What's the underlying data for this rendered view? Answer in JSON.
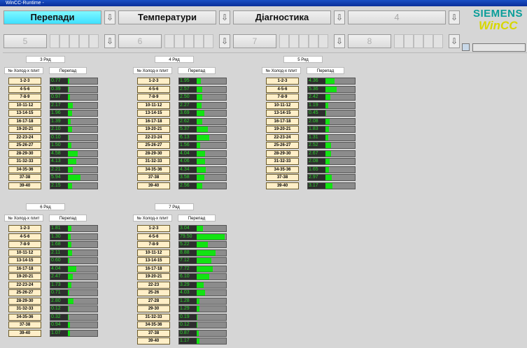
{
  "window": {
    "title": "WinCC-Runtime -"
  },
  "nav_row1": [
    {
      "label": "Перепади",
      "active": true
    },
    {
      "label": "Температури",
      "active": false
    },
    {
      "label": "Діагностика",
      "active": false
    },
    {
      "label": "4",
      "active": false
    }
  ],
  "nav_row2": [
    "5",
    "6",
    "7",
    "8"
  ],
  "arrow_glyph": "⇩",
  "logo": {
    "line1": "SIEMENS",
    "line2": "WinCC"
  },
  "column_headers": {
    "plates": "№ Холод-х плит",
    "drop": "Перепад"
  },
  "panels": [
    {
      "title": "3 Ряд",
      "rows": [
        {
          "label": "1-2-3",
          "value": "0.77"
        },
        {
          "label": "4-5-6",
          "value": "0.39"
        },
        {
          "label": "7-8-9",
          "value": "0.97"
        },
        {
          "label": "10-11-12",
          "value": "2.17"
        },
        {
          "label": "13-14-15",
          "value": "1.96"
        },
        {
          "label": "16-17-18",
          "value": "1.39"
        },
        {
          "label": "19-20-21",
          "value": "2.10"
        },
        {
          "label": "22-23-24",
          "value": "0.10"
        },
        {
          "label": "25-26-27",
          "value": "1.50"
        },
        {
          "label": "28-29-30",
          "value": "4.58"
        },
        {
          "label": "31-32-33",
          "value": "4.13"
        },
        {
          "label": "34-35-36",
          "value": "2.21"
        },
        {
          "label": "37-38",
          "value": "5.94"
        },
        {
          "label": "39-40",
          "value": "2.15"
        }
      ]
    },
    {
      "title": "4 Ряд",
      "rows": [
        {
          "label": "1-2-3",
          "value": "1.95"
        },
        {
          "label": "4-5-6",
          "value": "2.57"
        },
        {
          "label": "7-8-9",
          "value": "2.50"
        },
        {
          "label": "10-11-12",
          "value": "2.27"
        },
        {
          "label": "13-14-15",
          "value": "3.69"
        },
        {
          "label": "16-17-18",
          "value": "2.62"
        },
        {
          "label": "19-20-21",
          "value": "5.37"
        },
        {
          "label": "22-23-24",
          "value": "6.13"
        },
        {
          "label": "25-26-27",
          "value": "1.56"
        },
        {
          "label": "28-29-30",
          "value": "4.04"
        },
        {
          "label": "31-32-33",
          "value": "4.06"
        },
        {
          "label": "34-35-36",
          "value": "4.34"
        },
        {
          "label": "37-38",
          "value": "3.58"
        },
        {
          "label": "39-40",
          "value": "2.56"
        }
      ]
    },
    {
      "title": "5 Ряд",
      "rows": [
        {
          "label": "1-2-3",
          "value": "4.36"
        },
        {
          "label": "4-5-6",
          "value": "5.36"
        },
        {
          "label": "7-8-9",
          "value": "2.42"
        },
        {
          "label": "10-11-12",
          "value": "1.19"
        },
        {
          "label": "13-14-15",
          "value": "0.45"
        },
        {
          "label": "16-17-18",
          "value": "2.08"
        },
        {
          "label": "19-20-21",
          "value": "1.83"
        },
        {
          "label": "22-23-24",
          "value": "1.31"
        },
        {
          "label": "25-26-27",
          "value": "2.52"
        },
        {
          "label": "28-29-30",
          "value": "2.67"
        },
        {
          "label": "31-32-33",
          "value": "2.08"
        },
        {
          "label": "34-35-36",
          "value": "1.65"
        },
        {
          "label": "37-38",
          "value": "2.97"
        },
        {
          "label": "39-40",
          "value": "3.17"
        }
      ]
    },
    {
      "title": "6 Ряд",
      "rows": [
        {
          "label": "1-2-3",
          "value": "1.81"
        },
        {
          "label": "4-5-6",
          "value": "1.30"
        },
        {
          "label": "7-8-9",
          "value": "1.68"
        },
        {
          "label": "10-11-12",
          "value": "2.11"
        },
        {
          "label": "13-14-15",
          "value": "0.60"
        },
        {
          "label": "16-17-18",
          "value": "4.04"
        },
        {
          "label": "19-20-21",
          "value": "2.47"
        },
        {
          "label": "22-23-24",
          "value": "1.73"
        },
        {
          "label": "25-26-27",
          "value": "0.71"
        },
        {
          "label": "28-29-30",
          "value": "2.80"
        },
        {
          "label": "31-32-33",
          "value": "0.12"
        },
        {
          "label": "34-35-36",
          "value": "0.32"
        },
        {
          "label": "37-38",
          "value": "0.94"
        },
        {
          "label": "39-40",
          "value": "1.07"
        }
      ]
    },
    {
      "title": "7 Ряд",
      "rows": [
        {
          "label": "1-2-3",
          "value": "3.04"
        },
        {
          "label": "4-5-6",
          "value": "79.50"
        },
        {
          "label": "7-8-9",
          "value": "5.22"
        },
        {
          "label": "10-11-12",
          "value": "8.88"
        },
        {
          "label": "13-14-15",
          "value": "7.12"
        },
        {
          "label": "16-17-18",
          "value": "7.72"
        },
        {
          "label": "19-20-21",
          "value": "6.10"
        },
        {
          "label": "22-23",
          "value": "3.29"
        },
        {
          "label": "25-26",
          "value": "4.03"
        },
        {
          "label": "27-28",
          "value": "1.28"
        },
        {
          "label": "29-30",
          "value": "1.29"
        },
        {
          "label": "31-32-33",
          "value": "0.19"
        },
        {
          "label": "34-35-36",
          "value": "0.12"
        },
        {
          "label": "37-38",
          "value": "0.87"
        },
        {
          "label": "39-40",
          "value": "1.17"
        }
      ]
    }
  ],
  "colors": {
    "bar_fill": "#12e312",
    "value_text": "#2bd62b",
    "label_bg": "#ffefc8",
    "active_tab": "#3fe0ff"
  }
}
